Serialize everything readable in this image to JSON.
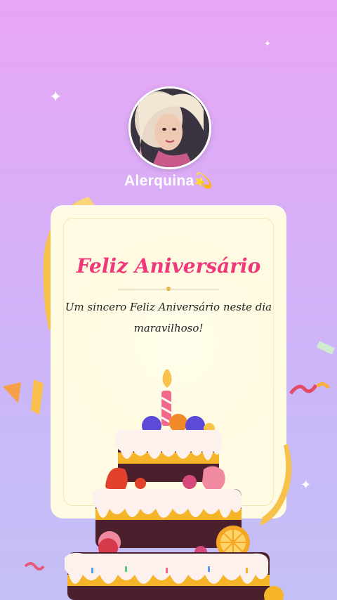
{
  "profile": {
    "name": "Alerquina",
    "badge_icon": "shooting-star-icon"
  },
  "card": {
    "title": "Feliz Aniversário",
    "message_line1": "Um sincero Feliz Aniversário neste dia",
    "message_line2": "maravilhoso!"
  },
  "colors": {
    "title": "#f0377a",
    "card_background": "#fffbe2",
    "background_top": "#e8a6f4",
    "background_bottom": "#c4c0f6"
  }
}
